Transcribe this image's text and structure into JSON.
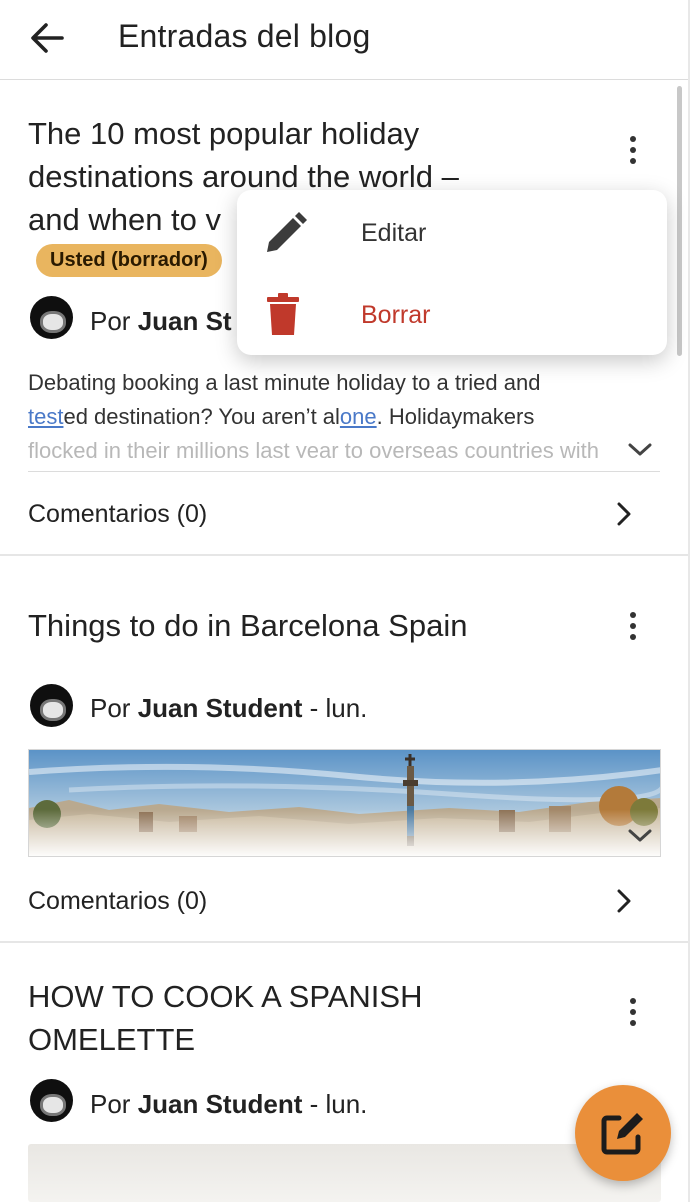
{
  "header": {
    "title": "Entradas del blog",
    "back_icon": "arrow-left-icon"
  },
  "posts": [
    {
      "title_lines": [
        "The 10 most popular holiday",
        "destinations around the world –",
        "and when to v"
      ],
      "badge": "Usted (borrador)",
      "author_prefix": "Por ",
      "author_name": "Juan St",
      "author_suffix": "",
      "excerpt": {
        "p1": "Debating booking a last minute holiday to a tried and",
        "p2a": "test",
        "p2b": "ed destination? You aren’t al",
        "p2c": "one",
        "p2d": ". Holidaymakers",
        "p3": "flocked in their millions last year to overseas countries with"
      },
      "comments": "Comentarios (0)"
    },
    {
      "title_lines": [
        "Things to do in Barcelona Spain"
      ],
      "author_prefix": "Por ",
      "author_name": "Juan Student",
      "author_suffix": " - lun.",
      "comments": "Comentarios (0)"
    },
    {
      "title_lines": [
        "HOW TO COOK A SPANISH",
        "OMELETTE"
      ],
      "author_prefix": "Por ",
      "author_name": "Juan Student",
      "author_suffix": " - lun."
    }
  ],
  "context_menu": {
    "items": [
      {
        "label": "Editar",
        "icon": "pencil-icon",
        "color": "#333333"
      },
      {
        "label": "Borrar",
        "icon": "trash-icon",
        "color": "#c0392b"
      }
    ]
  },
  "fab": {
    "icon": "compose-icon",
    "color": "#ea8f3a"
  },
  "colors": {
    "badge": "#e9b55f",
    "link": "#4a79c8",
    "danger": "#c0392b"
  }
}
